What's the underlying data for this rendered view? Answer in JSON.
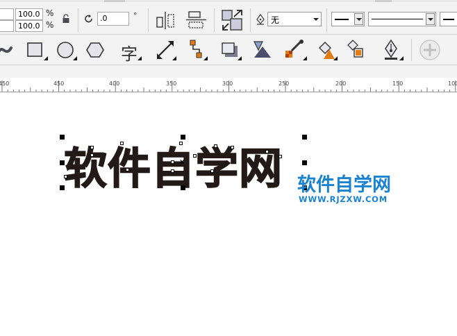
{
  "property_bar": {
    "scale_width": "100.0",
    "scale_height": "100.0",
    "percent_symbol": "%",
    "rotation_angle": ".0",
    "degree_symbol": "°",
    "outline_width_icon": "pen-nib-icon",
    "fill_none_label": "无"
  },
  "toolbox": {
    "text_tool_glyph": "字"
  },
  "ruler": {
    "labels": [
      "450",
      "400",
      "350",
      "300",
      "250",
      "200",
      "150",
      "100"
    ]
  },
  "canvas": {
    "selected_text": "软件自学网",
    "watermark": {
      "title": "软件自学网",
      "url": "WWW.RJZXW.COM"
    }
  },
  "colors": {
    "accent": "#1a83d1",
    "text_fill": "#231a17",
    "node_orange": "#e07b16"
  }
}
